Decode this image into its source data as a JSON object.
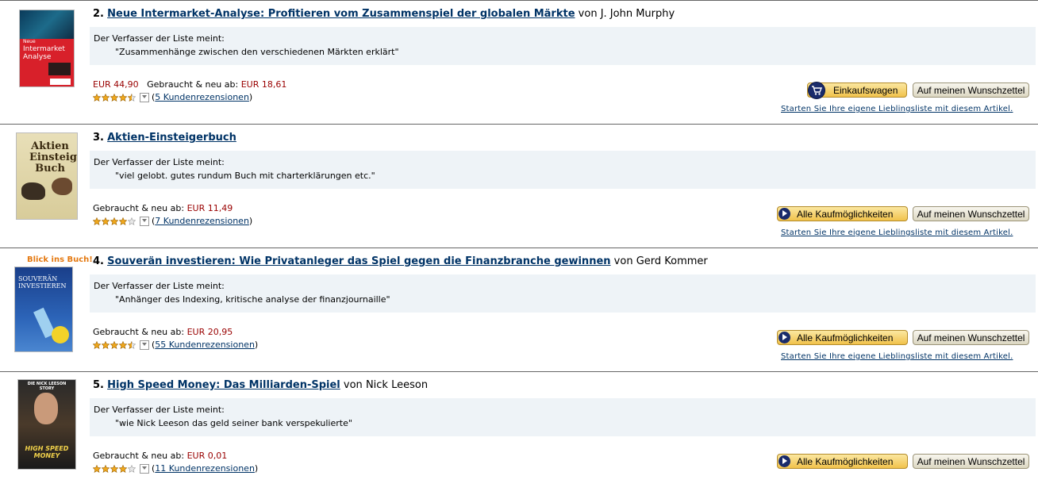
{
  "colors": {
    "link": "#003366",
    "price": "#990000",
    "comment_bg": "#eef3f7",
    "button_gold": "#f1c24c"
  },
  "common": {
    "comment_label": "Der Verfasser der Liste meint:",
    "wishlist_label": "Auf meinen Wunschzettel",
    "own_list_link": "Starten Sie Ihre eigene Lieblingsliste mit diesem Artikel.",
    "cart_label": "Einkaufswagen",
    "all_options_label": "Alle Kaufmöglichkeiten",
    "used_new_label": "Gebraucht & neu ab:",
    "by_label": "von"
  },
  "items": [
    {
      "number": "2.",
      "title": "Neue Intermarket-Analyse: Profitieren vom Zusammenspiel der globalen Märkte",
      "author": "J. John Murphy",
      "comment": "\"Zusammenhänge zwischen den verschiedenen Märkten erklärt\"",
      "price": "EUR 44,90",
      "used_price": "EUR 18,61",
      "rating": 4.5,
      "open_paren": "(",
      "reviews": "5 Kundenrezensionen",
      "close_paren": ")",
      "button": "cart",
      "cover_text_top": "Neue",
      "cover_text_main": "Intermarket Analyse"
    },
    {
      "number": "3.",
      "title": "Aktien-Einsteigerbuch",
      "author": "",
      "comment": "\"viel gelobt. gutes rundum Buch mit charterklärungen etc.\"",
      "used_price": "EUR 11,49",
      "rating": 4,
      "open_paren": "(",
      "reviews": "7 Kundenrezensionen",
      "close_paren": ")",
      "button": "all",
      "cover_text_main": "Aktien Einsteiger Buch"
    },
    {
      "number": "4.",
      "title": "Souverän investieren: Wie Privatanleger das Spiel gegen die Finanzbranche gewinnen",
      "author": "Gerd Kommer",
      "comment": "\"Anhänger des Indexing, kritische analyse der finanzjournaille\"",
      "used_price": "EUR 20,95",
      "rating": 4.5,
      "open_paren": "(",
      "reviews": "55 Kundenrezensionen",
      "close_paren": ")",
      "button": "all",
      "badge": "Blick ins Buch!",
      "cover_text_main": "SOUVERÄN INVESTIEREN"
    },
    {
      "number": "5.",
      "title": "High Speed Money: Das Milliarden-Spiel",
      "author": "Nick Leeson",
      "comment": "\"wie Nick Leeson das geld seiner bank verspekulierte\"",
      "used_price": "EUR 0,01",
      "rating": 4,
      "open_paren": "(",
      "reviews": "11 Kundenrezensionen",
      "close_paren": ")",
      "button": "all",
      "cover_text_top": "DIE NICK LEESON STORY",
      "cover_text_main": "HIGH SPEED MONEY"
    }
  ]
}
